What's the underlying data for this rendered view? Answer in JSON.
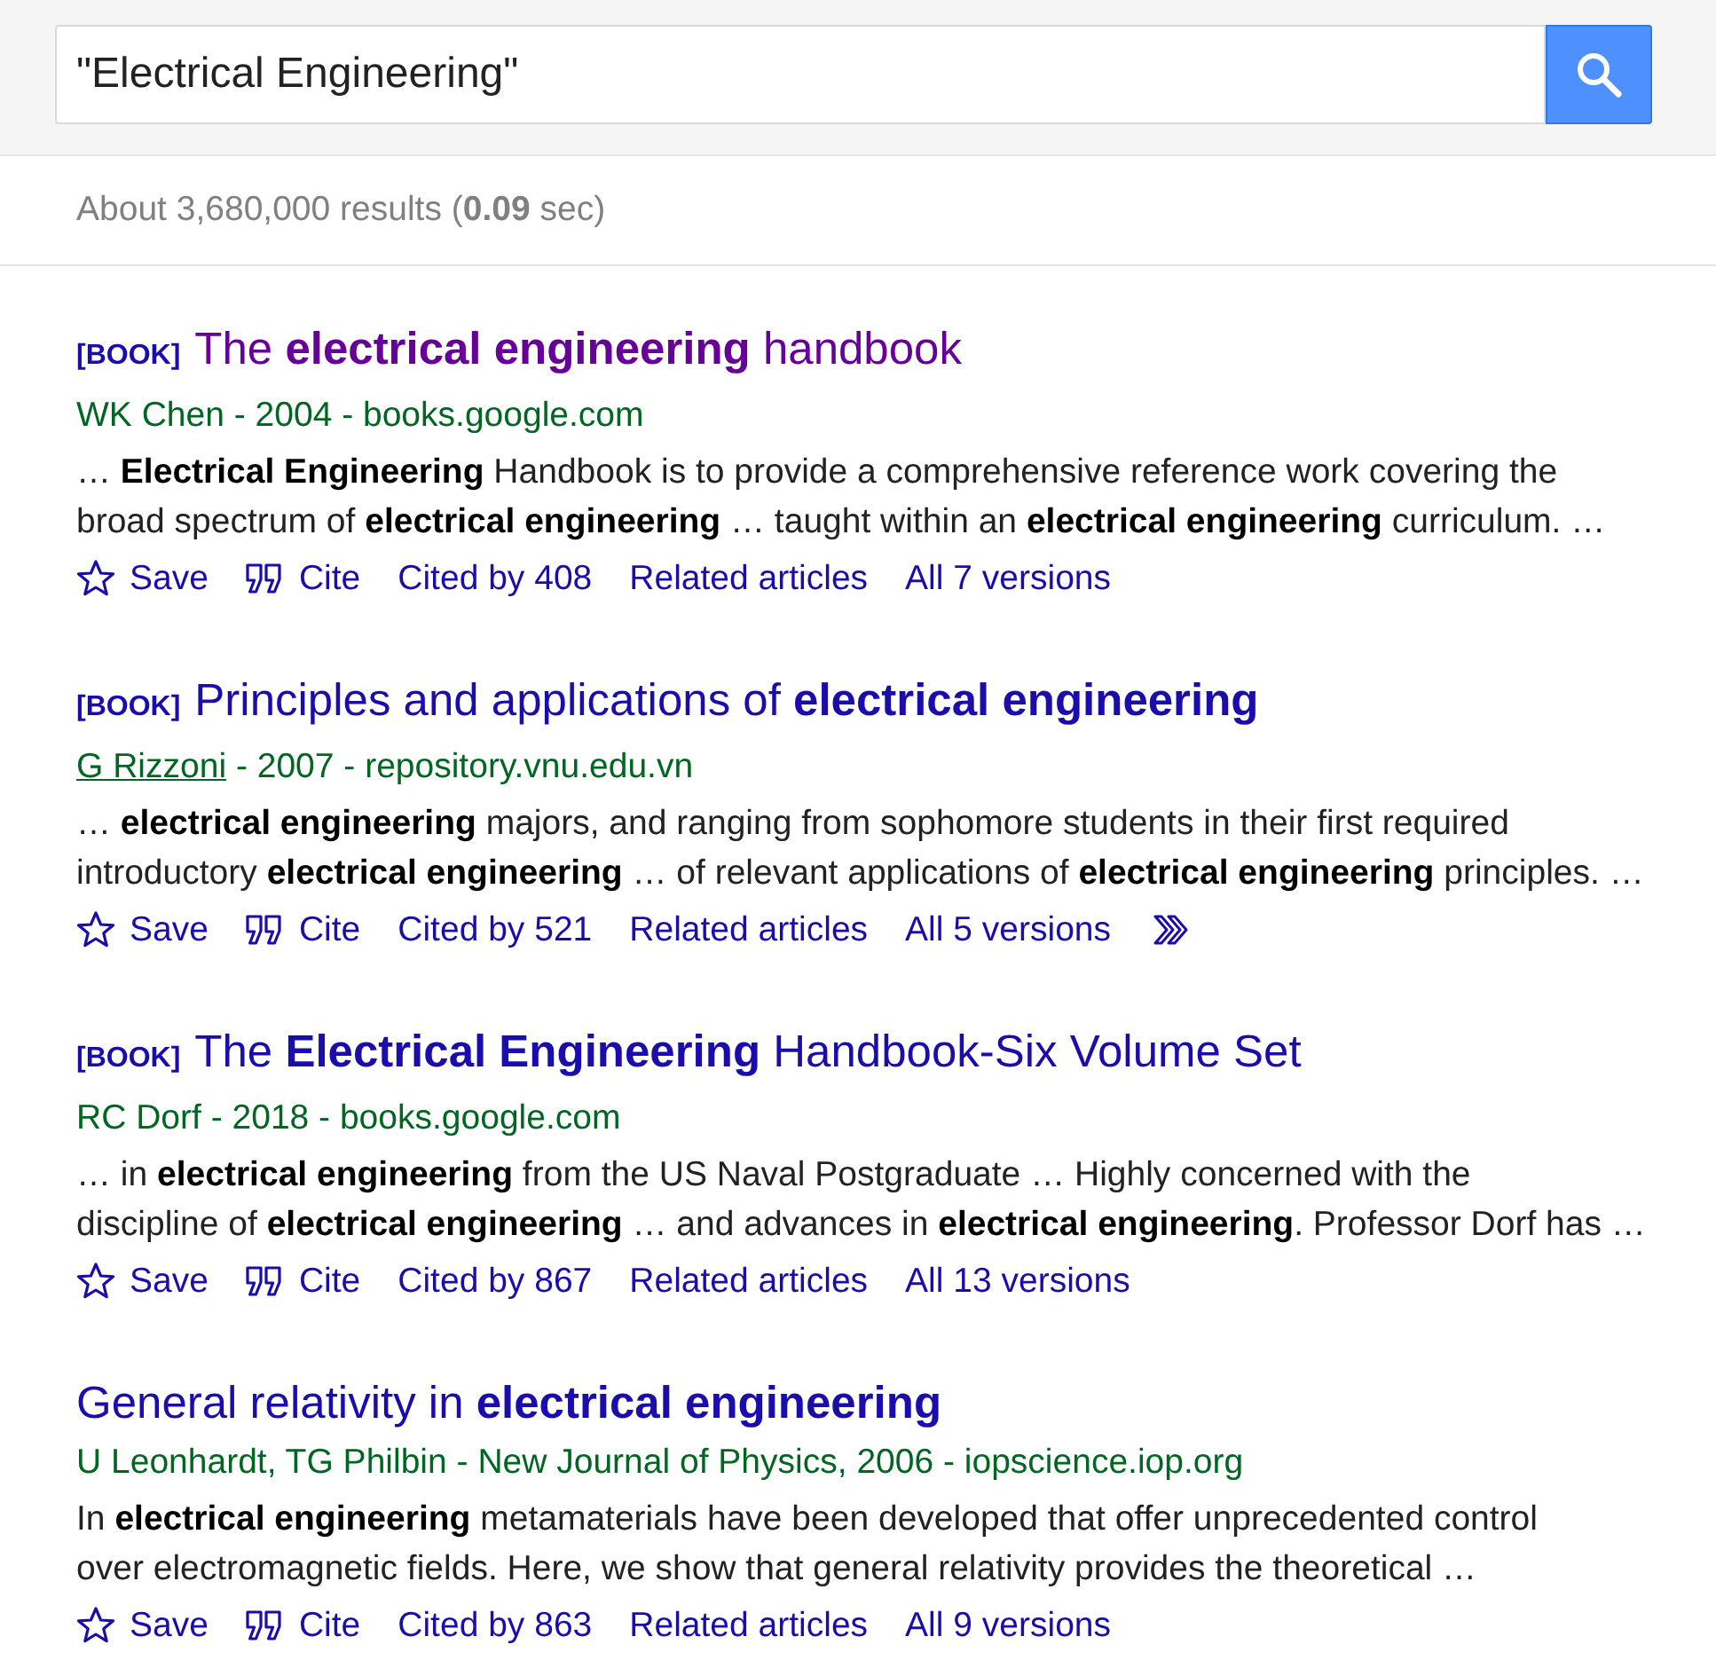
{
  "search": {
    "value": "\"Electrical Engineering\""
  },
  "results_count": "About 3,680,000 results (**0.09** sec)",
  "results": [
    {
      "tag": "[BOOK]",
      "title": "The **electrical engineering** handbook",
      "visited": true,
      "authors": "WK Chen",
      "author_link": false,
      "source": "- 2004 - books.google.com",
      "snippet": "… **Electrical Engineering** Handbook is to provide a comprehensive reference work covering the\nbroad spectrum of **electrical engineering** … taught within an **electrical engineering** curriculum. …",
      "actions": [
        {
          "kind": "save",
          "label": "Save"
        },
        {
          "kind": "cite",
          "label": "Cite"
        },
        {
          "kind": "cited_by",
          "label": "Cited by 408"
        },
        {
          "kind": "related",
          "label": "Related articles"
        },
        {
          "kind": "versions",
          "label": "All 7 versions"
        }
      ]
    },
    {
      "tag": "[BOOK]",
      "title": "Principles and applications of **electrical engineering**",
      "visited": false,
      "authors": "G Rizzoni",
      "author_link": true,
      "source": "- 2007 - repository.vnu.edu.vn",
      "snippet": "… **electrical engineering** majors, and ranging from sophomore students in their first required\nintroductory **electrical engineering** … of relevant applications of **electrical engineering** principles. …",
      "actions": [
        {
          "kind": "save",
          "label": "Save"
        },
        {
          "kind": "cite",
          "label": "Cite"
        },
        {
          "kind": "cited_by",
          "label": "Cited by 521"
        },
        {
          "kind": "related",
          "label": "Related articles"
        },
        {
          "kind": "versions",
          "label": "All 5 versions"
        },
        {
          "kind": "more"
        }
      ]
    },
    {
      "tag": "[BOOK]",
      "title": "The **Electrical Engineering** Handbook-Six Volume Set",
      "visited": false,
      "authors": "RC Dorf",
      "author_link": false,
      "source": "- 2018 - books.google.com",
      "snippet": "… in **electrical engineering** from the US Naval Postgraduate … Highly concerned with the\ndiscipline of **electrical engineering** … and advances in **electrical engineering**. Professor Dorf has …",
      "actions": [
        {
          "kind": "save",
          "label": "Save"
        },
        {
          "kind": "cite",
          "label": "Cite"
        },
        {
          "kind": "cited_by",
          "label": "Cited by 867"
        },
        {
          "kind": "related",
          "label": "Related articles"
        },
        {
          "kind": "versions",
          "label": "All 13 versions"
        }
      ]
    },
    {
      "title": "General relativity in **electrical engineering**",
      "visited": false,
      "authors": "U Leonhardt, TG Philbin",
      "author_link": false,
      "source": "- New Journal of Physics, 2006 - iopscience.iop.org",
      "snippet": "In **electrical engineering** metamaterials have been developed that offer unprecedented control\nover electromagnetic fields. Here, we show that general relativity provides the theoretical …",
      "actions": [
        {
          "kind": "save",
          "label": "Save"
        },
        {
          "kind": "cite",
          "label": "Cite"
        },
        {
          "kind": "cited_by",
          "label": "Cited by 863"
        },
        {
          "kind": "related",
          "label": "Related articles"
        },
        {
          "kind": "versions",
          "label": "All 9 versions"
        }
      ]
    }
  ]
}
